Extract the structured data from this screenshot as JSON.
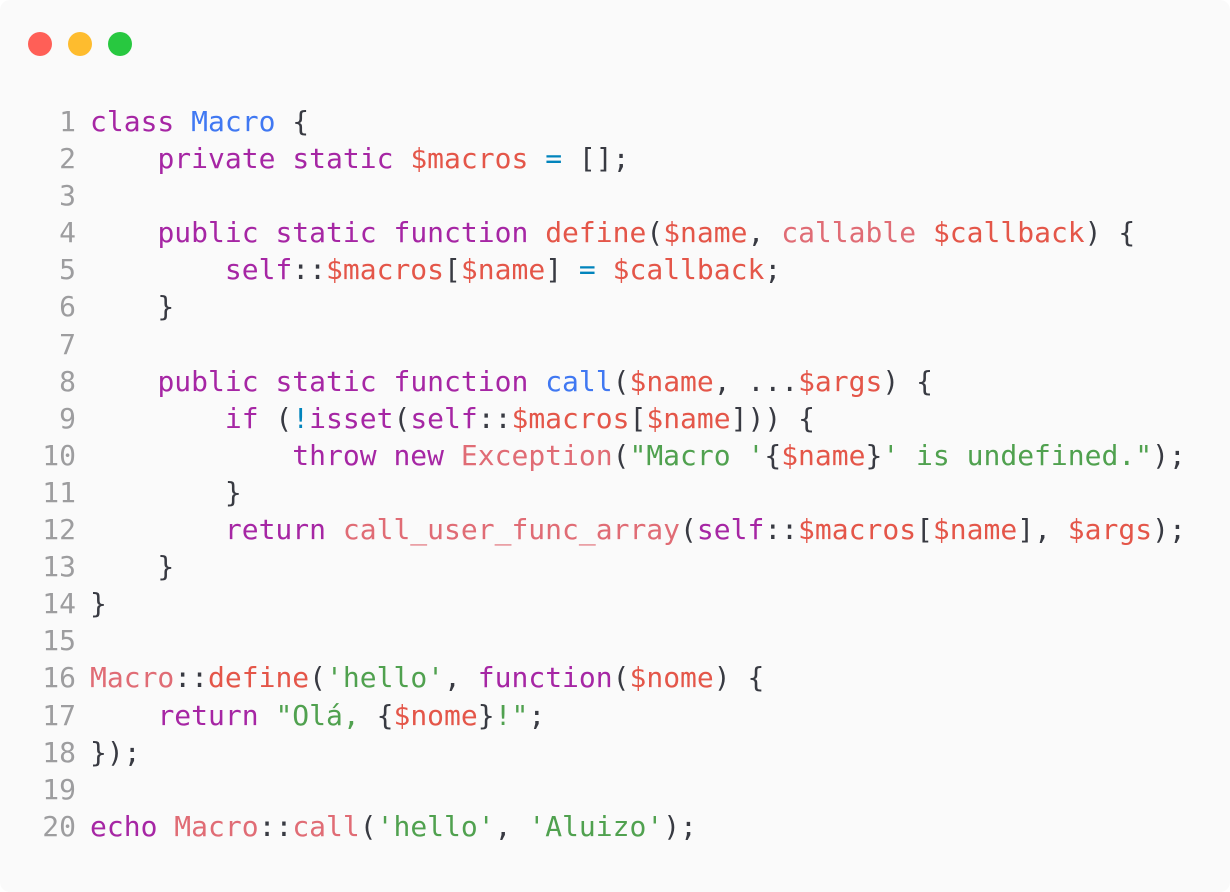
{
  "window": {
    "controls": [
      {
        "name": "close-button",
        "color": "#ff5f57"
      },
      {
        "name": "minimize-button",
        "color": "#febc2e"
      },
      {
        "name": "maximize-button",
        "color": "#28c840"
      }
    ]
  },
  "colors": {
    "keyword": "#a626a4",
    "class_name": "#4078f2",
    "variable": "#e45649",
    "operator": "#0184bc",
    "string": "#50a14f",
    "call": "#e06c75",
    "text": "#383a42",
    "line_number": "#9d9d9f"
  },
  "code_lines": [
    {
      "number": "1",
      "tokens": [
        [
          "kw",
          "class"
        ],
        [
          "t",
          " "
        ],
        [
          "cls",
          "Macro"
        ],
        [
          "t",
          " {"
        ]
      ]
    },
    {
      "number": "2",
      "tokens": [
        [
          "t",
          "    "
        ],
        [
          "kw",
          "private"
        ],
        [
          "t",
          " "
        ],
        [
          "kw",
          "static"
        ],
        [
          "t",
          " "
        ],
        [
          "var",
          "$macros"
        ],
        [
          "t",
          " "
        ],
        [
          "op",
          "="
        ],
        [
          "t",
          " [];"
        ]
      ]
    },
    {
      "number": "3",
      "tokens": []
    },
    {
      "number": "4",
      "tokens": [
        [
          "t",
          "    "
        ],
        [
          "kw",
          "public"
        ],
        [
          "t",
          " "
        ],
        [
          "kw",
          "static"
        ],
        [
          "t",
          " "
        ],
        [
          "kw",
          "function"
        ],
        [
          "t",
          " "
        ],
        [
          "var",
          "define"
        ],
        [
          "t",
          "("
        ],
        [
          "var",
          "$name"
        ],
        [
          "t",
          ", "
        ],
        [
          "call",
          "callable"
        ],
        [
          "t",
          " "
        ],
        [
          "var",
          "$callback"
        ],
        [
          "t",
          ") {"
        ]
      ]
    },
    {
      "number": "5",
      "tokens": [
        [
          "t",
          "        "
        ],
        [
          "kw",
          "self"
        ],
        [
          "t",
          "::"
        ],
        [
          "var",
          "$macros"
        ],
        [
          "t",
          "["
        ],
        [
          "var",
          "$name"
        ],
        [
          "t",
          "] "
        ],
        [
          "op",
          "="
        ],
        [
          "t",
          " "
        ],
        [
          "var",
          "$callback"
        ],
        [
          "t",
          ";"
        ]
      ]
    },
    {
      "number": "6",
      "tokens": [
        [
          "t",
          "    }"
        ]
      ]
    },
    {
      "number": "7",
      "tokens": []
    },
    {
      "number": "8",
      "tokens": [
        [
          "t",
          "    "
        ],
        [
          "kw",
          "public"
        ],
        [
          "t",
          " "
        ],
        [
          "kw",
          "static"
        ],
        [
          "t",
          " "
        ],
        [
          "kw",
          "function"
        ],
        [
          "t",
          " "
        ],
        [
          "cls",
          "call"
        ],
        [
          "t",
          "("
        ],
        [
          "var",
          "$name"
        ],
        [
          "t",
          ", ..."
        ],
        [
          "var",
          "$args"
        ],
        [
          "t",
          ") {"
        ]
      ]
    },
    {
      "number": "9",
      "tokens": [
        [
          "t",
          "        "
        ],
        [
          "kw",
          "if"
        ],
        [
          "t",
          " ("
        ],
        [
          "op",
          "!"
        ],
        [
          "kw",
          "isset"
        ],
        [
          "t",
          "("
        ],
        [
          "kw",
          "self"
        ],
        [
          "t",
          "::"
        ],
        [
          "var",
          "$macros"
        ],
        [
          "t",
          "["
        ],
        [
          "var",
          "$name"
        ],
        [
          "t",
          "])) {"
        ]
      ]
    },
    {
      "number": "10",
      "tokens": [
        [
          "t",
          "            "
        ],
        [
          "kw",
          "throw"
        ],
        [
          "t",
          " "
        ],
        [
          "kw",
          "new"
        ],
        [
          "t",
          " "
        ],
        [
          "call",
          "Exception"
        ],
        [
          "t",
          "("
        ],
        [
          "str",
          "\"Macro '"
        ],
        [
          "t",
          "{"
        ],
        [
          "var",
          "$name"
        ],
        [
          "t",
          "}"
        ],
        [
          "str",
          "' is undefined.\""
        ],
        [
          "t",
          ");"
        ]
      ]
    },
    {
      "number": "11",
      "tokens": [
        [
          "t",
          "        }"
        ]
      ]
    },
    {
      "number": "12",
      "tokens": [
        [
          "t",
          "        "
        ],
        [
          "kw",
          "return"
        ],
        [
          "t",
          " "
        ],
        [
          "call",
          "call_user_func_array"
        ],
        [
          "t",
          "("
        ],
        [
          "kw",
          "self"
        ],
        [
          "t",
          "::"
        ],
        [
          "var",
          "$macros"
        ],
        [
          "t",
          "["
        ],
        [
          "var",
          "$name"
        ],
        [
          "t",
          "], "
        ],
        [
          "var",
          "$args"
        ],
        [
          "t",
          ");"
        ]
      ]
    },
    {
      "number": "13",
      "tokens": [
        [
          "t",
          "    }"
        ]
      ]
    },
    {
      "number": "14",
      "tokens": [
        [
          "t",
          "}"
        ]
      ]
    },
    {
      "number": "15",
      "tokens": []
    },
    {
      "number": "16",
      "tokens": [
        [
          "call",
          "Macro"
        ],
        [
          "t",
          "::"
        ],
        [
          "var",
          "define"
        ],
        [
          "t",
          "("
        ],
        [
          "str",
          "'hello'"
        ],
        [
          "t",
          ", "
        ],
        [
          "kw",
          "function"
        ],
        [
          "t",
          "("
        ],
        [
          "var",
          "$nome"
        ],
        [
          "t",
          ") {"
        ]
      ]
    },
    {
      "number": "17",
      "tokens": [
        [
          "t",
          "    "
        ],
        [
          "kw",
          "return"
        ],
        [
          "t",
          " "
        ],
        [
          "str",
          "\"Olá, "
        ],
        [
          "t",
          "{"
        ],
        [
          "var",
          "$nome"
        ],
        [
          "t",
          "}"
        ],
        [
          "str",
          "!\""
        ],
        [
          "t",
          ";"
        ]
      ]
    },
    {
      "number": "18",
      "tokens": [
        [
          "t",
          "});"
        ]
      ]
    },
    {
      "number": "19",
      "tokens": []
    },
    {
      "number": "20",
      "tokens": [
        [
          "kw",
          "echo"
        ],
        [
          "t",
          " "
        ],
        [
          "call",
          "Macro"
        ],
        [
          "t",
          "::"
        ],
        [
          "call",
          "call"
        ],
        [
          "t",
          "("
        ],
        [
          "str",
          "'hello'"
        ],
        [
          "t",
          ", "
        ],
        [
          "str",
          "'Aluizo'"
        ],
        [
          "t",
          ");"
        ]
      ]
    }
  ]
}
